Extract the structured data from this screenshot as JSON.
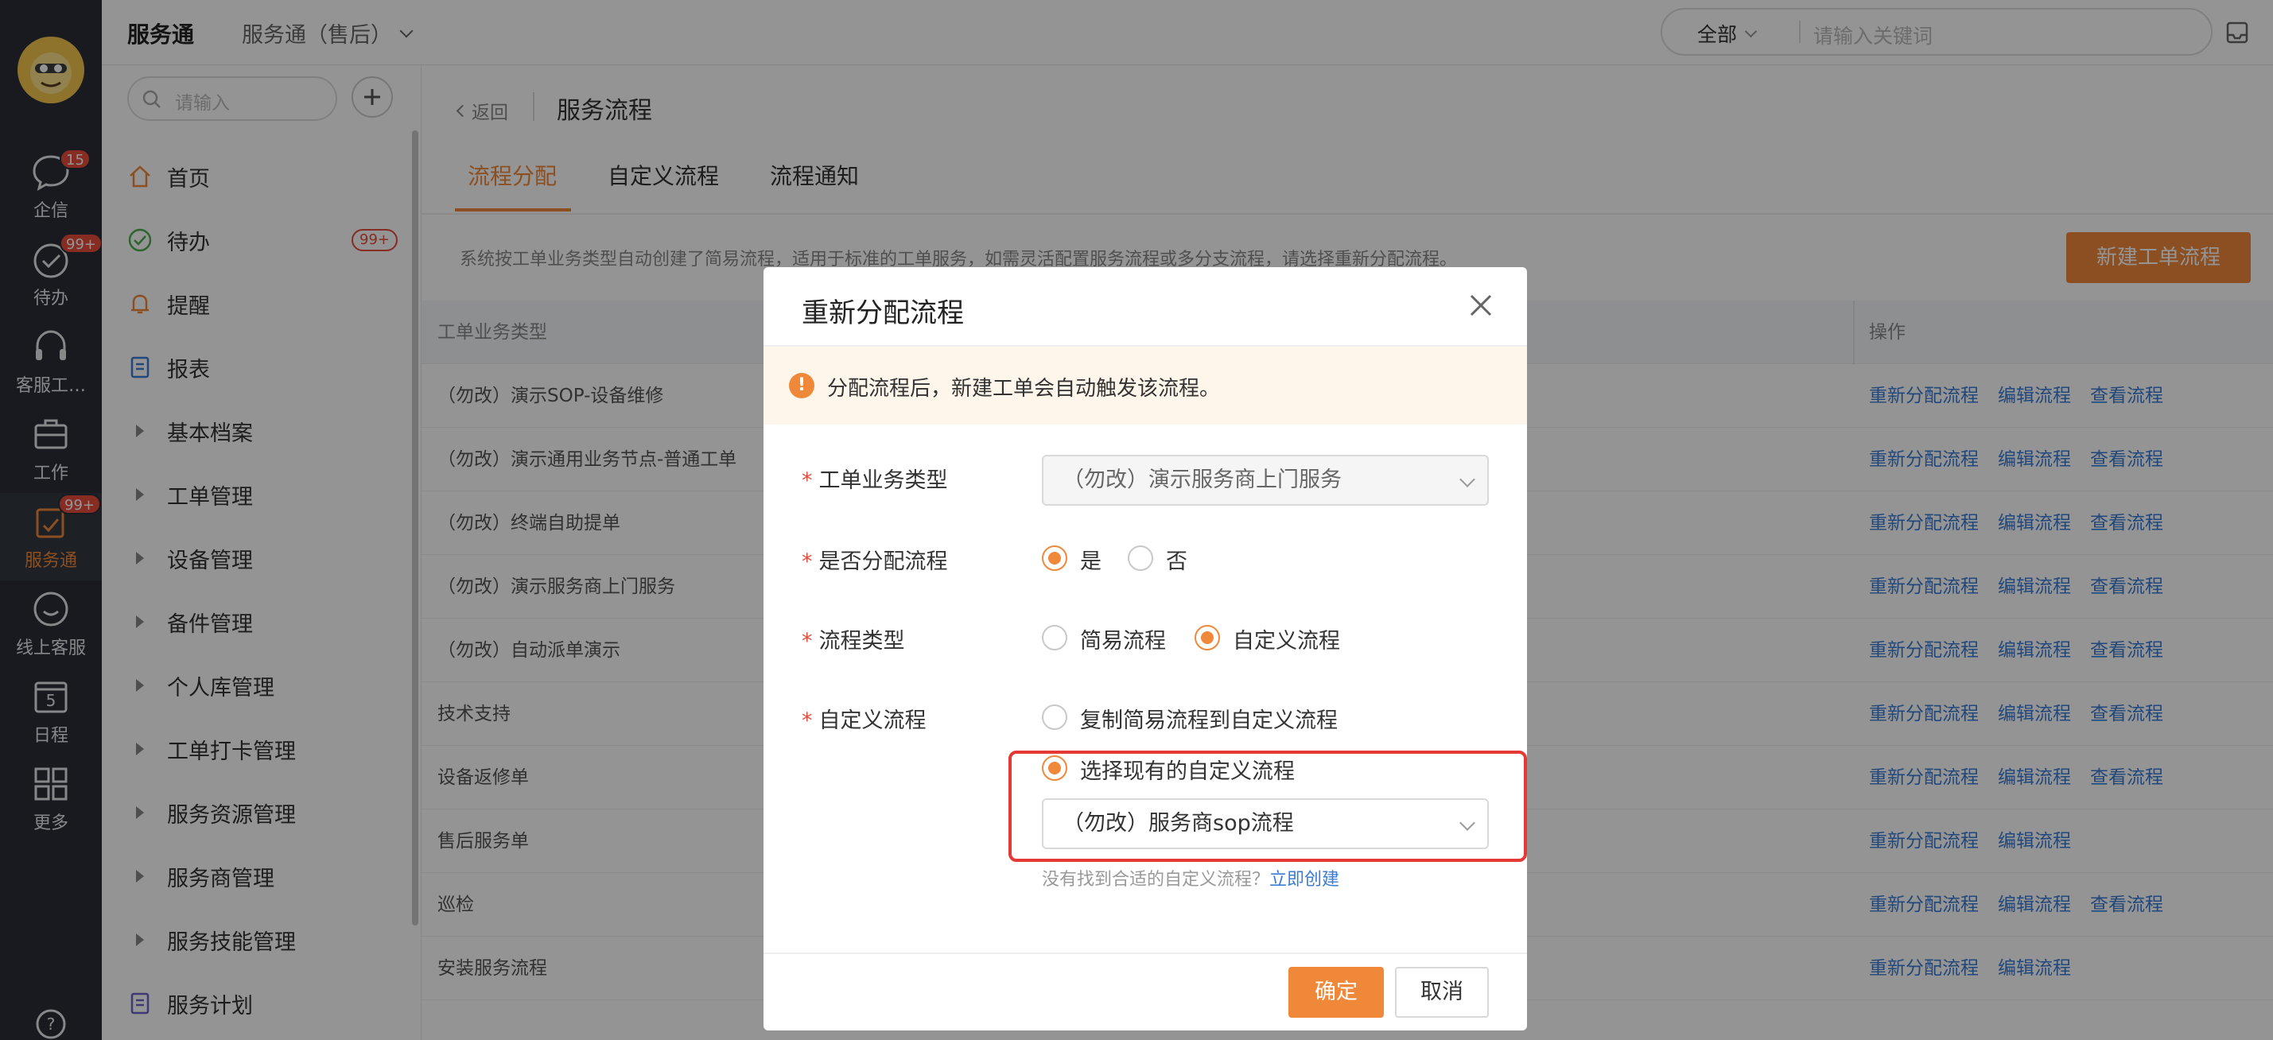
{
  "app": {
    "name": "服务通",
    "switcher": "服务通（售后）"
  },
  "topbar": {
    "scope": "全部",
    "search_placeholder": "请输入关键词"
  },
  "rail": [
    {
      "label": "企信",
      "icon": "chat-icon",
      "badge": "15"
    },
    {
      "label": "待办",
      "icon": "check-circle-icon",
      "badge": "99+"
    },
    {
      "label": "客服工…",
      "icon": "headset-icon",
      "badge": ""
    },
    {
      "label": "工作",
      "icon": "briefcase-icon",
      "badge": ""
    },
    {
      "label": "服务通",
      "icon": "service-icon",
      "badge": "99+"
    },
    {
      "label": "线上客服",
      "icon": "smile-icon",
      "badge": ""
    },
    {
      "label": "日程",
      "icon": "calendar-icon",
      "badge": "",
      "day": "5"
    },
    {
      "label": "更多",
      "icon": "grid-icon",
      "badge": ""
    }
  ],
  "sidebar": {
    "search_placeholder": "请输入",
    "items": [
      {
        "label": "首页",
        "icon": "home-icon"
      },
      {
        "label": "待办",
        "icon": "check-circle-icon",
        "badge": "99+"
      },
      {
        "label": "提醒",
        "icon": "bell-icon"
      },
      {
        "label": "报表",
        "icon": "report-icon"
      },
      {
        "label": "基本档案",
        "icon": "arrow"
      },
      {
        "label": "工单管理",
        "icon": "arrow"
      },
      {
        "label": "设备管理",
        "icon": "arrow"
      },
      {
        "label": "备件管理",
        "icon": "arrow"
      },
      {
        "label": "个人库管理",
        "icon": "arrow"
      },
      {
        "label": "工单打卡管理",
        "icon": "arrow"
      },
      {
        "label": "服务资源管理",
        "icon": "arrow"
      },
      {
        "label": "服务商管理",
        "icon": "arrow"
      },
      {
        "label": "服务技能管理",
        "icon": "arrow"
      },
      {
        "label": "服务计划",
        "icon": "plan-icon"
      }
    ]
  },
  "page": {
    "back": "返回",
    "title": "服务流程",
    "tabs": [
      "流程分配",
      "自定义流程",
      "流程通知"
    ],
    "notice": "系统按工单业务类型自动创建了简易流程，适用于标准的工单服务，如需灵活配置服务流程或多分支流程，请选择重新分配流程。",
    "new_button": "新建工单流程",
    "columns": {
      "type": "工单业务类型",
      "ops": "操作"
    },
    "rows": [
      {
        "type": "（勿改）演示SOP-设备维修",
        "ops": [
          "重新分配流程",
          "编辑流程",
          "查看流程"
        ]
      },
      {
        "type": "（勿改）演示通用业务节点-普通工单",
        "ops": [
          "重新分配流程",
          "编辑流程",
          "查看流程"
        ]
      },
      {
        "type": "（勿改）终端自助提单",
        "ops": [
          "重新分配流程",
          "编辑流程",
          "查看流程"
        ]
      },
      {
        "type": "（勿改）演示服务商上门服务",
        "ops": [
          "重新分配流程",
          "编辑流程",
          "查看流程"
        ]
      },
      {
        "type": "（勿改）自动派单演示",
        "ops": [
          "重新分配流程",
          "编辑流程",
          "查看流程"
        ]
      },
      {
        "type": "技术支持",
        "ops": [
          "重新分配流程",
          "编辑流程",
          "查看流程"
        ]
      },
      {
        "type": "设备返修单",
        "ops": [
          "重新分配流程",
          "编辑流程",
          "查看流程"
        ]
      },
      {
        "type": "售后服务单",
        "ops": [
          "重新分配流程",
          "编辑流程"
        ]
      },
      {
        "type": "巡检",
        "ops": [
          "重新分配流程",
          "编辑流程",
          "查看流程"
        ]
      },
      {
        "type": "安装服务流程",
        "ops": [
          "重新分配流程",
          "编辑流程"
        ]
      }
    ]
  },
  "modal": {
    "title": "重新分配流程",
    "warning": "分配流程后，新建工单会自动触发该流程。",
    "fields": {
      "biz_type": {
        "label": "工单业务类型",
        "value": "（勿改）演示服务商上门服务"
      },
      "assign": {
        "label": "是否分配流程",
        "options": [
          "是",
          "否"
        ],
        "selected": "是"
      },
      "flow_type": {
        "label": "流程类型",
        "options": [
          "简易流程",
          "自定义流程"
        ],
        "selected": "自定义流程"
      },
      "custom_flow": {
        "label": "自定义流程",
        "options": [
          "复制简易流程到自定义流程",
          "选择现有的自定义流程"
        ],
        "selected": "选择现有的自定义流程",
        "select_value": "（勿改）服务商sop流程"
      }
    },
    "hint": "没有找到合适的自定义流程？",
    "hint_link": "立即创建",
    "ok": "确定",
    "cancel": "取消"
  },
  "colors": {
    "accent": "#f0883a",
    "link": "#3a7bd5",
    "highlight": "#e53935",
    "rail": "#2b2e36"
  }
}
